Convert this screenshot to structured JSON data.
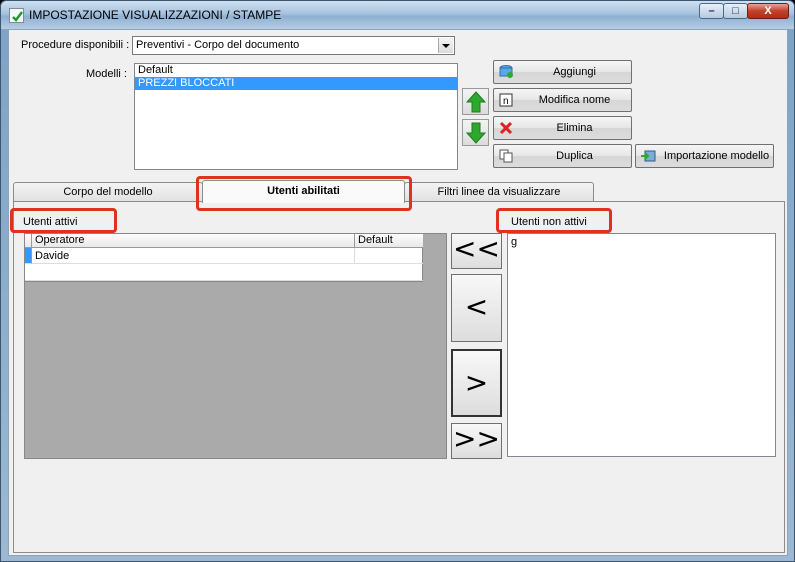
{
  "window": {
    "title": "IMPOSTAZIONE VISUALIZZAZIONI / STAMPE",
    "controls": {
      "minimize": "–",
      "maximize": "□",
      "close": "X"
    }
  },
  "form": {
    "procedures_label": "Procedure disponibili :",
    "procedures_value": "Preventivi - Corpo del documento",
    "models_label": "Modelli :",
    "models": [
      "Default",
      "PREZZI BLOCCATI"
    ],
    "selected_model_index": 1
  },
  "buttons": {
    "add": "Aggiungi",
    "rename": "Modifica nome",
    "delete": "Elimina",
    "duplicate": "Duplica",
    "import": "Importazione modello"
  },
  "tabs": [
    {
      "label": "Corpo del modello"
    },
    {
      "label": "Utenti abilitati"
    },
    {
      "label": "Filtri linee da visualizzare"
    }
  ],
  "active_tab_index": 1,
  "users_panel": {
    "active_label": "Utenti attivi",
    "inactive_label": "Utenti non attivi",
    "grid_headers": {
      "operator": "Operatore",
      "default": "Default"
    },
    "active_users": [
      {
        "operator": "Davide",
        "default": ""
      }
    ],
    "inactive_text": "g",
    "move_all_left": "<<",
    "move_left": "<",
    "move_right": ">",
    "move_all_right": ">>"
  },
  "colors": {
    "highlight": "#e0301e",
    "selection": "#3399ff",
    "arrow_green": "#2ea82e"
  }
}
